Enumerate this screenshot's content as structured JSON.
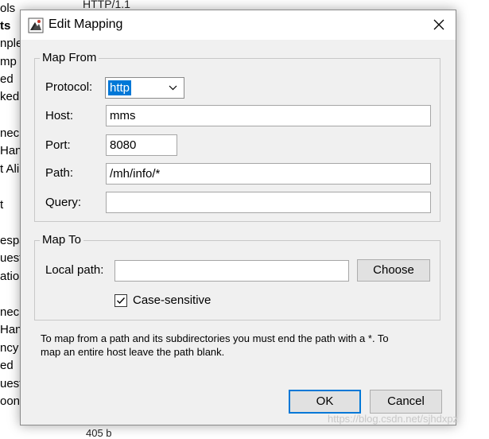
{
  "background": {
    "top_text": "HTTP/1.1",
    "bottom_text": "405 b",
    "sidebar_fragments": [
      "ols",
      "ts",
      "nple",
      "mp",
      "ed",
      "ked",
      "nec",
      "Han",
      "t Ali",
      "t",
      "espa",
      "uest",
      "ation",
      "nec",
      "Han",
      "ncy",
      "ed",
      "uest",
      "oons"
    ]
  },
  "dialog": {
    "title": "Edit Mapping",
    "map_from": {
      "legend": "Map From",
      "protocol_label": "Protocol:",
      "protocol_value": "http",
      "host_label": "Host:",
      "host_value": "mms",
      "port_label": "Port:",
      "port_value": "8080",
      "path_label": "Path:",
      "path_value": "/mh/info/*",
      "query_label": "Query:",
      "query_value": ""
    },
    "map_to": {
      "legend": "Map To",
      "local_path_label": "Local path:",
      "local_path_value": "",
      "choose_label": "Choose",
      "case_sensitive_label": "Case-sensitive",
      "case_sensitive_checked": true
    },
    "info_text_line1": "To map from a path and its subdirectories you must end the path with a *. To",
    "info_text_line2": "map an entire host leave the path blank.",
    "ok_label": "OK",
    "cancel_label": "Cancel"
  },
  "watermark": "https://blog.csdn.net/sjhdxpz",
  "colors": {
    "accent": "#0078d7",
    "dialog_bg": "#f0f0f0",
    "button_bg": "#e1e1e1"
  }
}
